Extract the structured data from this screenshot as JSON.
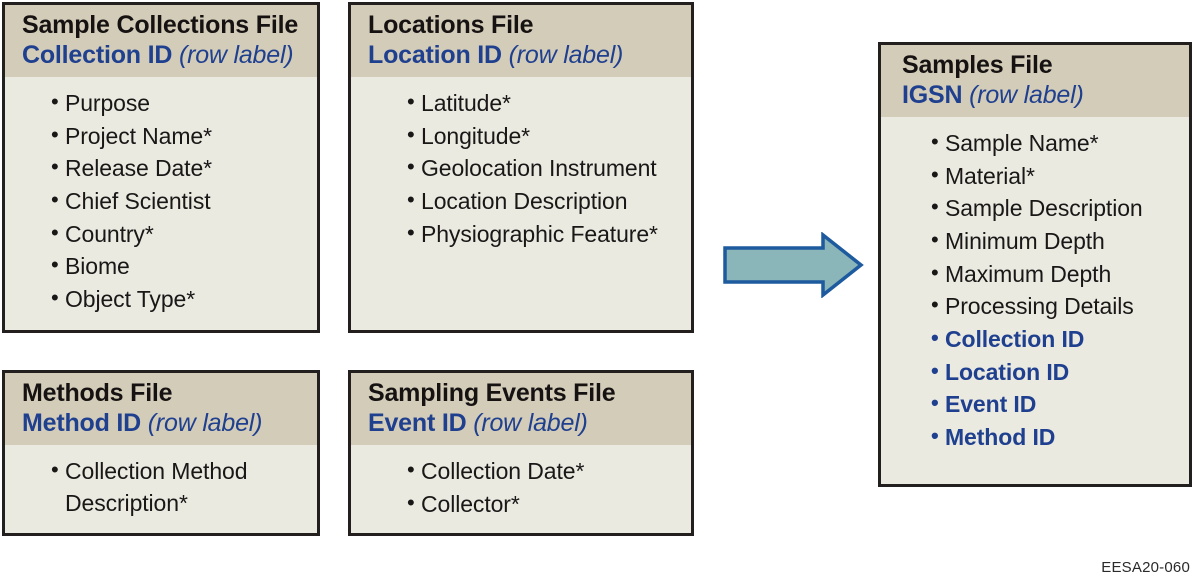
{
  "diagram": {
    "footer_code": "EESA20-060",
    "colors": {
      "header_band": "#d3ccb9",
      "body_fill": "#ebeae1",
      "border": "#231f1e",
      "link_blue": "#1f3f8f",
      "arrow_fill": "#8ab5b9",
      "arrow_stroke": "#1d5a9e"
    },
    "arrow": {
      "name": "flow-arrow-right",
      "direction": "right"
    },
    "boxes": [
      {
        "id": "sample-collections",
        "title": "Sample Collections File",
        "key": "Collection ID",
        "row_label": "(row label)",
        "fields": [
          {
            "label": "Purpose",
            "link": false
          },
          {
            "label": "Project Name*",
            "link": false
          },
          {
            "label": "Release Date*",
            "link": false
          },
          {
            "label": "Chief Scientist",
            "link": false
          },
          {
            "label": "Country*",
            "link": false
          },
          {
            "label": "Biome",
            "link": false
          },
          {
            "label": "Object Type*",
            "link": false
          }
        ]
      },
      {
        "id": "locations",
        "title": "Locations File",
        "key": "Location ID",
        "row_label": "(row label)",
        "fields": [
          {
            "label": "Latitude*",
            "link": false
          },
          {
            "label": "Longitude*",
            "link": false
          },
          {
            "label": "Geolocation Instrument",
            "link": false
          },
          {
            "label": "Location Description",
            "link": false
          },
          {
            "label": "Physiographic Feature*",
            "link": false
          }
        ]
      },
      {
        "id": "methods",
        "title": "Methods File",
        "key": "Method ID",
        "row_label": "(row label)",
        "fields": [
          {
            "label": "Collection Method Description*",
            "link": false,
            "wrap": true
          }
        ]
      },
      {
        "id": "sampling-events",
        "title": "Sampling Events File",
        "key": "Event ID",
        "row_label": "(row label)",
        "fields": [
          {
            "label": "Collection Date*",
            "link": false
          },
          {
            "label": "Collector*",
            "link": false
          }
        ]
      },
      {
        "id": "samples",
        "title": "Samples File",
        "key": "IGSN",
        "row_label": "(row label)",
        "fields": [
          {
            "label": "Sample Name*",
            "link": false
          },
          {
            "label": "Material*",
            "link": false
          },
          {
            "label": "Sample Description",
            "link": false
          },
          {
            "label": "Minimum Depth",
            "link": false
          },
          {
            "label": "Maximum Depth",
            "link": false
          },
          {
            "label": "Processing Details",
            "link": false
          },
          {
            "label": "Collection ID",
            "link": true
          },
          {
            "label": "Location ID",
            "link": true
          },
          {
            "label": "Event ID",
            "link": true
          },
          {
            "label": "Method ID",
            "link": true
          }
        ]
      }
    ]
  }
}
